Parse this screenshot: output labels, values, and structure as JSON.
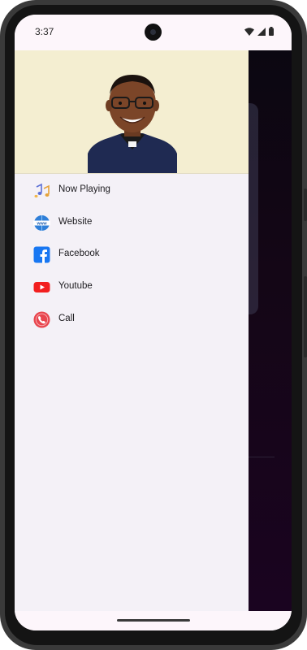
{
  "status_bar": {
    "time": "3:37",
    "icons": [
      "wifi-icon",
      "signal-icon",
      "battery-icon"
    ]
  },
  "drawer": {
    "header": {
      "image": "profile-photo"
    },
    "items": [
      {
        "label": "Now Playing",
        "icon": "music-notes-icon"
      },
      {
        "label": "Website",
        "icon": "globe-www-icon"
      },
      {
        "label": "Facebook",
        "icon": "facebook-icon"
      },
      {
        "label": "Youtube",
        "icon": "youtube-icon"
      },
      {
        "label": "Call",
        "icon": "phone-call-icon"
      }
    ]
  },
  "colors": {
    "drawer_header_bg": "#f4eed1",
    "drawer_bg": "#f4f1f7",
    "app_bg": "#140616",
    "facebook_blue": "#1877f2",
    "youtube_red": "#ff0000",
    "call_red": "#e8454e"
  }
}
